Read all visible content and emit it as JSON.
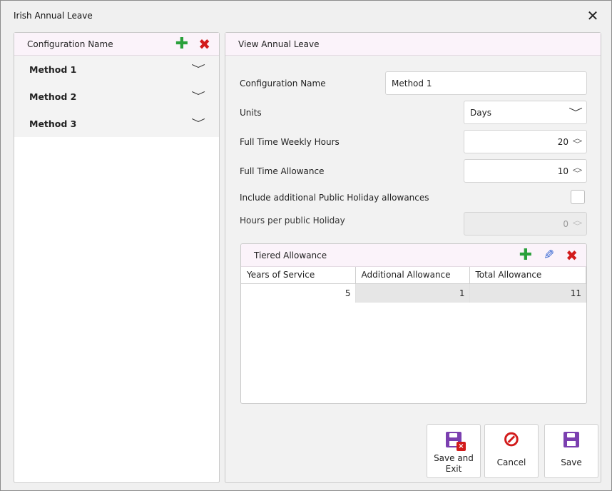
{
  "window": {
    "title": "Irish Annual Leave",
    "close_glyph": "✕"
  },
  "left_panel": {
    "header": "Configuration Name",
    "add_glyph": "✚",
    "delete_glyph": "✖",
    "items": [
      {
        "label": "Method 1",
        "chevron": "﹀"
      },
      {
        "label": "Method 2",
        "chevron": "﹀"
      },
      {
        "label": "Method 3",
        "chevron": "﹀"
      }
    ]
  },
  "right_panel": {
    "header": "View Annual Leave",
    "fields": {
      "configuration_name": {
        "label": "Configuration Name",
        "value": "Method 1"
      },
      "units": {
        "label": "Units",
        "value": "Days",
        "chevron": "﹀"
      },
      "weekly_hours": {
        "label": "Full Time Weekly Hours",
        "value": "20"
      },
      "allowance": {
        "label": "Full Time Allowance",
        "value": "10"
      },
      "public_holiday": {
        "label": "Include additional Public Holiday allowances",
        "checked": false
      },
      "hours_per_holiday": {
        "label": "Hours per public Holiday",
        "value": "0"
      }
    },
    "spin_up": "︿",
    "spin_down": "﹀"
  },
  "tiered": {
    "title": "Tiered Allowance",
    "add_glyph": "✚",
    "edit_glyph": "✎",
    "delete_glyph": "✖",
    "columns": [
      "Years of Service",
      "Additional Allowance",
      "Total Allowance"
    ],
    "rows": [
      {
        "years": "5",
        "additional": "1",
        "total": "11"
      }
    ]
  },
  "buttons": {
    "save_exit_line1": "Save and",
    "save_exit_line2": "Exit",
    "cancel": "Cancel",
    "save": "Save",
    "cancel_glyph": "⊘",
    "xbadge": "×"
  },
  "colors": {
    "accent_purple": "#7b3fb0",
    "add_green": "#2aa03b",
    "delete_red": "#d21b1b",
    "edit_blue": "#2b5fd0"
  }
}
